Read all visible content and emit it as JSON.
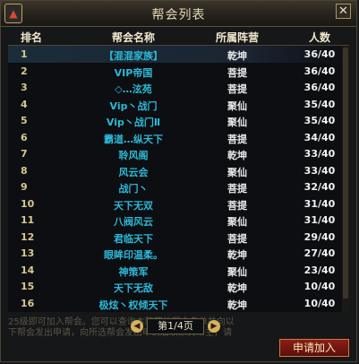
{
  "window": {
    "title": "帮会列表",
    "close_label": "✕"
  },
  "table": {
    "headers": {
      "rank": "排名",
      "name": "帮会名称",
      "camp": "所属阵营",
      "count": "人数"
    },
    "rows": [
      {
        "rank": "1",
        "name": "【混混家族】",
        "camp": "乾坤",
        "count": "36/40"
      },
      {
        "rank": "2",
        "name": "VIP帝国",
        "camp": "菩提",
        "count": "36/40"
      },
      {
        "rank": "3",
        "name": "◇…泫苑",
        "camp": "菩提",
        "count": "36/40"
      },
      {
        "rank": "4",
        "name": "Vip丶战门",
        "camp": "聚仙",
        "count": "35/40"
      },
      {
        "rank": "5",
        "name": "Vip丶战门Ⅱ",
        "camp": "聚仙",
        "count": "35/40"
      },
      {
        "rank": "6",
        "name": "霸道…纵天下",
        "camp": "菩提",
        "count": "34/40"
      },
      {
        "rank": "7",
        "name": "聆风阁",
        "camp": "乾坤",
        "count": "33/40"
      },
      {
        "rank": "8",
        "name": "风云会",
        "camp": "聚仙",
        "count": "33/40"
      },
      {
        "rank": "9",
        "name": "战门丶",
        "camp": "菩提",
        "count": "32/40"
      },
      {
        "rank": "10",
        "name": "天下无双",
        "camp": "菩提",
        "count": "31/40"
      },
      {
        "rank": "11",
        "name": "八阀风云",
        "camp": "聚仙",
        "count": "31/40"
      },
      {
        "rank": "12",
        "name": "君临天下",
        "camp": "菩提",
        "count": "29/40"
      },
      {
        "rank": "13",
        "name": "眼眸印温柔。",
        "camp": "乾坤",
        "count": "27/40"
      },
      {
        "rank": "14",
        "name": "神策军",
        "camp": "聚仙",
        "count": "23/40"
      },
      {
        "rank": "15",
        "name": "天下无敌",
        "camp": "乾坤",
        "count": "10/40"
      },
      {
        "rank": "16",
        "name": "极炫丶权倾天下",
        "camp": "乾坤",
        "count": "10/40"
      }
    ]
  },
  "pager": {
    "label": "第1/4页",
    "prev": "◀",
    "next": "▶"
  },
  "hint_text": "25级即可加入帮会。您可以查询本阵营的帮会名单并向以下帮会发出申请，向所选帮会发出申请后联系其帮主，请",
  "apply_button": "申请加入",
  "colors": {
    "accent": "#2db8d6",
    "title": "#e7d9b2",
    "button": "#7a1a14"
  }
}
